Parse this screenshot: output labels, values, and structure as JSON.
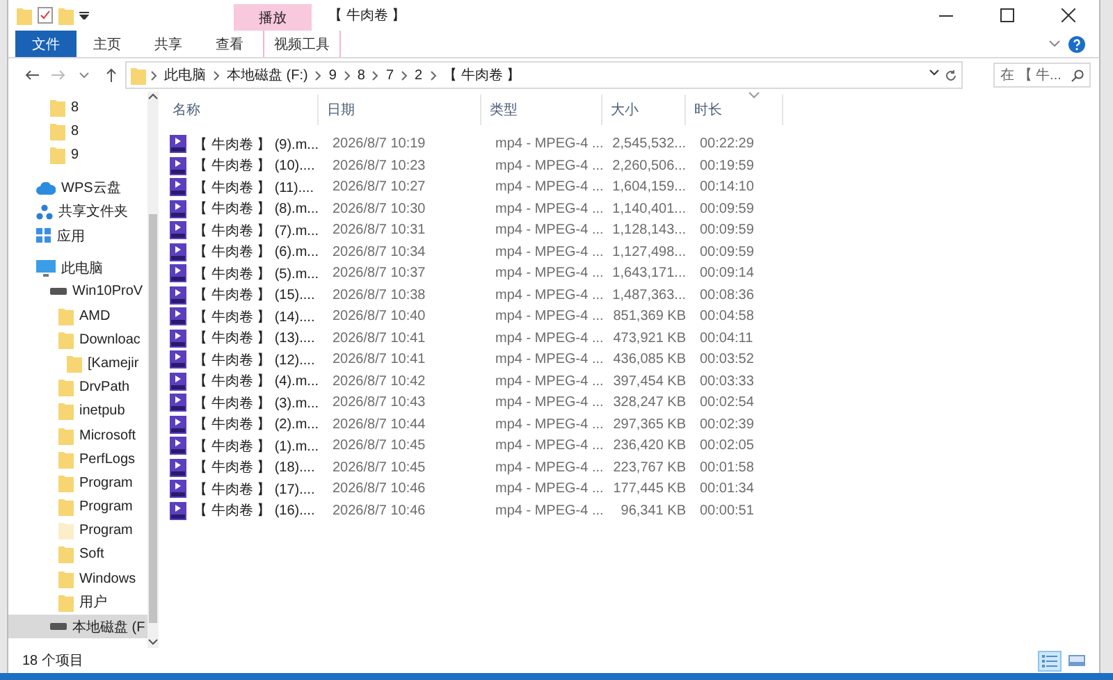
{
  "window": {
    "title": "【 牛肉卷 】",
    "context_group": "播放"
  },
  "ribbon": {
    "tabs": [
      {
        "label": "文件",
        "kind": "file"
      },
      {
        "label": "主页",
        "kind": "tab"
      },
      {
        "label": "共享",
        "kind": "tab"
      },
      {
        "label": "查看",
        "kind": "tab"
      },
      {
        "label": "视频工具",
        "kind": "contextual"
      }
    ]
  },
  "address": {
    "crumbs": [
      "此电脑",
      "本地磁盘 (F:)",
      "9",
      "8",
      "7",
      "2",
      "【 牛肉卷 】"
    ],
    "search": {
      "placeholder": "在 【 牛..."
    }
  },
  "nav": {
    "sections": [
      {
        "kind": "continued",
        "items": [
          {
            "label": "8",
            "kind": "folder",
            "selected": false
          },
          {
            "label": "8",
            "kind": "folder",
            "selected": false
          },
          {
            "label": "9",
            "kind": "folder",
            "selected": false
          }
        ]
      },
      {
        "kind": "root",
        "items": [
          {
            "label": "WPS云盘",
            "kind": "cloud",
            "selected": false
          },
          {
            "label": "共享文件夹",
            "kind": "share",
            "selected": false
          },
          {
            "label": "应用",
            "kind": "apps",
            "selected": false
          }
        ]
      },
      {
        "kind": "root",
        "items": [
          {
            "label": "此电脑",
            "kind": "pc",
            "selected": false,
            "children": [
              {
                "label": "Win10ProV",
                "kind": "drive",
                "selected": false,
                "children": [
                  {
                    "label": "AMD",
                    "kind": "folder",
                    "selected": false
                  },
                  {
                    "label": "Downloac",
                    "kind": "folder",
                    "selected": false,
                    "children": [
                      {
                        "label": "[Kamejir",
                        "kind": "folder",
                        "selected": false
                      }
                    ]
                  },
                  {
                    "label": "DrvPath",
                    "kind": "folder",
                    "selected": false
                  },
                  {
                    "label": "inetpub",
                    "kind": "folder",
                    "selected": false
                  },
                  {
                    "label": "Microsoft",
                    "kind": "folder",
                    "selected": false
                  },
                  {
                    "label": "PerfLogs",
                    "kind": "folder",
                    "selected": false
                  },
                  {
                    "label": "Program",
                    "kind": "folder",
                    "selected": false
                  },
                  {
                    "label": "Program",
                    "kind": "folder",
                    "selected": false
                  },
                  {
                    "label": "Program",
                    "kind": "hidden-folder",
                    "selected": false
                  },
                  {
                    "label": "Soft",
                    "kind": "folder",
                    "selected": false
                  },
                  {
                    "label": "Windows",
                    "kind": "folder",
                    "selected": false
                  },
                  {
                    "label": "用户",
                    "kind": "folder",
                    "selected": false
                  }
                ]
              },
              {
                "label": "本地磁盘 (F",
                "kind": "drive",
                "selected": true
              }
            ]
          }
        ]
      }
    ]
  },
  "table": {
    "columns": [
      "名称",
      "日期",
      "类型",
      "大小",
      "时长"
    ],
    "rows": [
      {
        "name": "【 牛肉卷 】 (9).m...",
        "date": "2026/8/7 10:19",
        "type": "mp4 - MPEG-4 ...",
        "size": "2,545,532...",
        "duration": "00:22:29"
      },
      {
        "name": "【 牛肉卷 】 (10)....",
        "date": "2026/8/7 10:23",
        "type": "mp4 - MPEG-4 ...",
        "size": "2,260,506...",
        "duration": "00:19:59"
      },
      {
        "name": "【 牛肉卷 】 (11)....",
        "date": "2026/8/7 10:27",
        "type": "mp4 - MPEG-4 ...",
        "size": "1,604,159...",
        "duration": "00:14:10"
      },
      {
        "name": "【 牛肉卷 】 (8).m...",
        "date": "2026/8/7 10:30",
        "type": "mp4 - MPEG-4 ...",
        "size": "1,140,401...",
        "duration": "00:09:59"
      },
      {
        "name": "【 牛肉卷 】 (7).m...",
        "date": "2026/8/7 10:31",
        "type": "mp4 - MPEG-4 ...",
        "size": "1,128,143...",
        "duration": "00:09:59"
      },
      {
        "name": "【 牛肉卷 】 (6).m...",
        "date": "2026/8/7 10:34",
        "type": "mp4 - MPEG-4 ...",
        "size": "1,127,498...",
        "duration": "00:09:59"
      },
      {
        "name": "【 牛肉卷 】 (5).m...",
        "date": "2026/8/7 10:37",
        "type": "mp4 - MPEG-4 ...",
        "size": "1,643,171...",
        "duration": "00:09:14"
      },
      {
        "name": "【 牛肉卷 】 (15)....",
        "date": "2026/8/7 10:38",
        "type": "mp4 - MPEG-4 ...",
        "size": "1,487,363...",
        "duration": "00:08:36"
      },
      {
        "name": "【 牛肉卷 】 (14)....",
        "date": "2026/8/7 10:40",
        "type": "mp4 - MPEG-4 ...",
        "size": "851,369 KB",
        "duration": "00:04:58"
      },
      {
        "name": "【 牛肉卷 】 (13)....",
        "date": "2026/8/7 10:41",
        "type": "mp4 - MPEG-4 ...",
        "size": "473,921 KB",
        "duration": "00:04:11"
      },
      {
        "name": "【 牛肉卷 】 (12)....",
        "date": "2026/8/7 10:41",
        "type": "mp4 - MPEG-4 ...",
        "size": "436,085 KB",
        "duration": "00:03:52"
      },
      {
        "name": "【 牛肉卷 】 (4).m...",
        "date": "2026/8/7 10:42",
        "type": "mp4 - MPEG-4 ...",
        "size": "397,454 KB",
        "duration": "00:03:33"
      },
      {
        "name": "【 牛肉卷 】 (3).m...",
        "date": "2026/8/7 10:43",
        "type": "mp4 - MPEG-4 ...",
        "size": "328,247 KB",
        "duration": "00:02:54"
      },
      {
        "name": "【 牛肉卷 】 (2).m...",
        "date": "2026/8/7 10:44",
        "type": "mp4 - MPEG-4 ...",
        "size": "297,365 KB",
        "duration": "00:02:39"
      },
      {
        "name": "【 牛肉卷 】 (1).m...",
        "date": "2026/8/7 10:45",
        "type": "mp4 - MPEG-4 ...",
        "size": "236,420 KB",
        "duration": "00:02:05"
      },
      {
        "name": "【 牛肉卷 】 (18)....",
        "date": "2026/8/7 10:45",
        "type": "mp4 - MPEG-4 ...",
        "size": "223,767 KB",
        "duration": "00:01:58"
      },
      {
        "name": "【 牛肉卷 】 (17)....",
        "date": "2026/8/7 10:46",
        "type": "mp4 - MPEG-4 ...",
        "size": "177,445 KB",
        "duration": "00:01:34"
      },
      {
        "name": "【 牛肉卷 】 (16)....",
        "date": "2026/8/7 10:46",
        "type": "mp4 - MPEG-4 ...",
        "size": "96,341 KB",
        "duration": "00:00:51"
      }
    ]
  },
  "status_bar": {
    "count": "18 个项目",
    "views": [
      {
        "kind": "details",
        "selected": true
      },
      {
        "kind": "tiles",
        "selected": false
      }
    ]
  }
}
